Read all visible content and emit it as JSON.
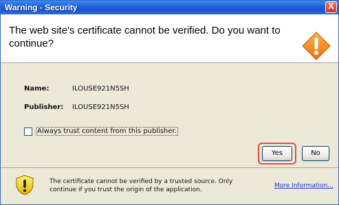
{
  "window": {
    "title": "Warning - Security",
    "close_glyph": "X"
  },
  "header": {
    "message": "The web site's certificate cannot be verified.  Do you want to continue?",
    "icon": "warning-diamond-icon"
  },
  "details": {
    "name_label": "Name:",
    "name_value": "ILOUSE921N5SH",
    "publisher_label": "Publisher:",
    "publisher_value": "ILOUSE921N5SH"
  },
  "options": {
    "always_trust_label": "Always trust content from this publisher.",
    "always_trust_checked": false
  },
  "buttons": {
    "yes_label": "Yes",
    "no_label": "No"
  },
  "footer": {
    "icon": "yellow-shield-icon",
    "message": "The certificate cannot be verified by a trusted source.  Only continue if you trust the origin of the application.",
    "more_info_label": "More Information..."
  },
  "colors": {
    "title_bar": "#1f5fd6",
    "warning_orange": "#f08a1e",
    "highlight_red": "#e14c48",
    "link_blue": "#1a3fb6"
  }
}
